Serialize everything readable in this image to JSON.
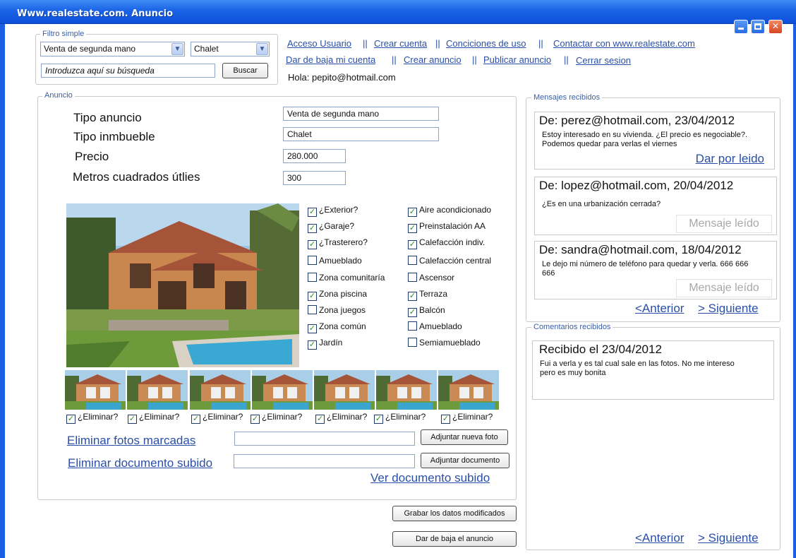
{
  "window": {
    "title": "Www.realestate.com. Anuncio"
  },
  "filter": {
    "legend": "Filtro simple",
    "operation": "Venta de segunda mano",
    "property_type": "Chalet",
    "search_placeholder": "Introduzca aquí su búsqueda",
    "search_button": "Buscar"
  },
  "nav": {
    "row1": [
      "Acceso Usuario",
      "Crear cuenta",
      "Conciciones de uso",
      "Contactar con www.realestate.com"
    ],
    "row2": [
      "Dar de baja mi cuenta",
      "Crear anuncio",
      "Publicar anuncio",
      "Cerrar sesion"
    ],
    "separator": "||",
    "greeting": "Hola: pepito@hotmail.com"
  },
  "ad": {
    "legend": "Anuncio",
    "fields": [
      {
        "label": "Tipo anuncio",
        "value": "Venta de segunda mano"
      },
      {
        "label": "Tipo inmbueble",
        "value": "Chalet"
      },
      {
        "label": "Precio",
        "value": "280.000"
      },
      {
        "label": "Metros cuadrados útlies",
        "value": "300"
      }
    ],
    "features_left": [
      {
        "label": "¿Exterior?",
        "checked": true
      },
      {
        "label": "¿Garaje?",
        "checked": true
      },
      {
        "label": "¿Trasterero?",
        "checked": true
      },
      {
        "label": "Amueblado",
        "checked": false
      },
      {
        "label": "Zona comunitaría",
        "checked": false
      },
      {
        "label": "Zona piscina",
        "checked": true
      },
      {
        "label": "Zona juegos",
        "checked": false
      },
      {
        "label": "Zona común",
        "checked": true
      },
      {
        "label": "Jardín",
        "checked": true
      }
    ],
    "features_right": [
      {
        "label": "Aire acondicionado",
        "checked": true
      },
      {
        "label": "Preinstalación AA",
        "checked": true
      },
      {
        "label": "Calefacción indiv.",
        "checked": true
      },
      {
        "label": "Calefacción central",
        "checked": false
      },
      {
        "label": "Ascensor",
        "checked": false
      },
      {
        "label": "Terraza",
        "checked": true
      },
      {
        "label": "Balcón",
        "checked": true
      },
      {
        "label": "Amueblado",
        "checked": false
      },
      {
        "label": "Semiamueblado",
        "checked": false
      }
    ],
    "thumb_delete_label": "¿Eliminar?",
    "thumb_count": 7,
    "delete_photos_link": "Eliminar fotos marcadas",
    "attach_photo_button": "Adjuntar nueva foto",
    "delete_doc_link": "Eliminar documento subido",
    "attach_doc_button": "Adjuntar documento",
    "view_doc_link": "Ver documento subido",
    "save_button": "Grabar los datos modificados",
    "unpublish_button": "Dar de baja el anuncio"
  },
  "messages": {
    "legend": "Mensajes recibidos",
    "items": [
      {
        "from": "De: perez@hotmail.com, 23/04/2012",
        "body": "Estoy interesado en su vivienda. ¿El precio es negociable?. Podemos quedar para verlas el viernes",
        "action": "Dar por leido"
      },
      {
        "from": "De: lopez@hotmail.com, 20/04/2012",
        "body": "¿Es en una urbanización cerrada?",
        "action": "Mensaje leído"
      },
      {
        "from": "De: sandra@hotmail.com, 18/04/2012",
        "body": "Le dejo mi número de teléfono para quedar y verla. 666 666 666",
        "action": "Mensaje leído"
      }
    ],
    "prev": "<Anterior",
    "next": "> Siguiente"
  },
  "comments": {
    "legend": "Comentarios recibidos",
    "items": [
      {
        "title": "Recibido el 23/04/2012",
        "body": "Fui a verla y es tal cual sale en las fotos. No me intereso pero es muy bonita"
      }
    ],
    "prev": "<Anterior",
    "next": "> Siguiente"
  },
  "colors": {
    "titlebar": "#1a63e6",
    "link": "#2a4fa8",
    "legend": "#3a5fa7",
    "check": "#2a8a2a"
  }
}
